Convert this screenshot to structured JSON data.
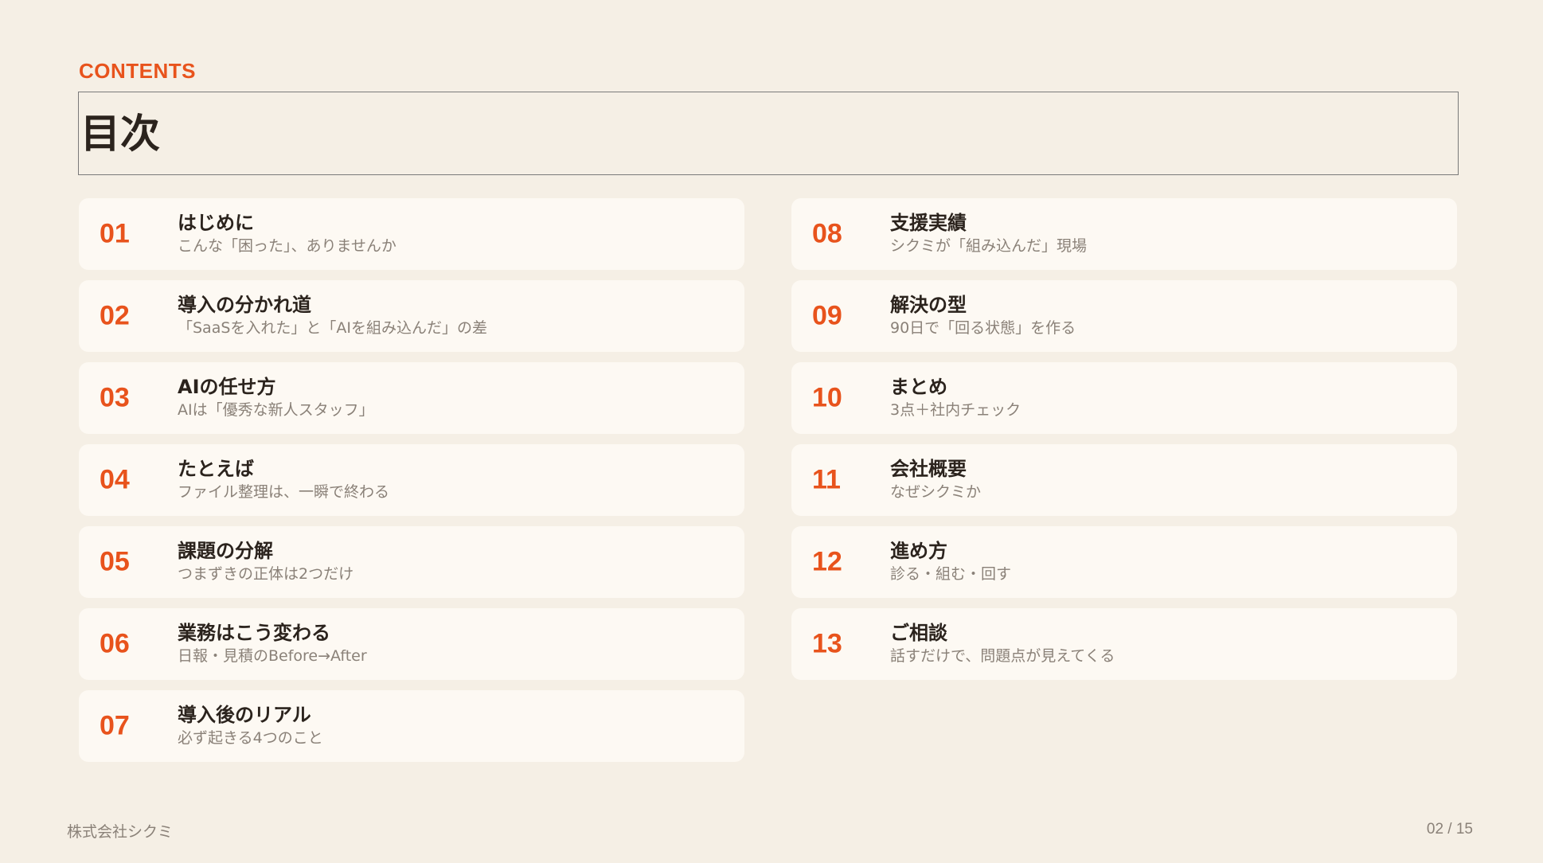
{
  "header": {
    "kicker": "CONTENTS",
    "title": "目次"
  },
  "colors": {
    "accent": "#e8531c",
    "background": "#f5efe5",
    "card": "#fdf9f3",
    "text": "#2b231d",
    "muted": "#8a8178"
  },
  "toc_left": [
    {
      "num": "01",
      "title": "はじめに",
      "desc": "こんな「困った」、ありませんか"
    },
    {
      "num": "02",
      "title": "導入の分かれ道",
      "desc": "「SaaSを入れた」と「AIを組み込んだ」の差"
    },
    {
      "num": "03",
      "title": "AIの任せ方",
      "desc": "AIは「優秀な新人スタッフ」"
    },
    {
      "num": "04",
      "title": "たとえば",
      "desc": "ファイル整理は、一瞬で終わる"
    },
    {
      "num": "05",
      "title": "課題の分解",
      "desc": "つまずきの正体は2つだけ"
    },
    {
      "num": "06",
      "title": "業務はこう変わる",
      "desc": "日報・見積のBefore→After"
    },
    {
      "num": "07",
      "title": "導入後のリアル",
      "desc": "必ず起きる4つのこと"
    }
  ],
  "toc_right": [
    {
      "num": "08",
      "title": "支援実績",
      "desc": "シクミが「組み込んだ」現場"
    },
    {
      "num": "09",
      "title": "解決の型",
      "desc": "90日で「回る状態」を作る"
    },
    {
      "num": "10",
      "title": "まとめ",
      "desc": "3点＋社内チェック"
    },
    {
      "num": "11",
      "title": "会社概要",
      "desc": "なぜシクミか"
    },
    {
      "num": "12",
      "title": "進め方",
      "desc": "診る・組む・回す"
    },
    {
      "num": "13",
      "title": "ご相談",
      "desc": "話すだけで、問題点が見えてくる"
    }
  ],
  "footer": {
    "company": "株式会社シクミ",
    "page": "02 / 15"
  }
}
